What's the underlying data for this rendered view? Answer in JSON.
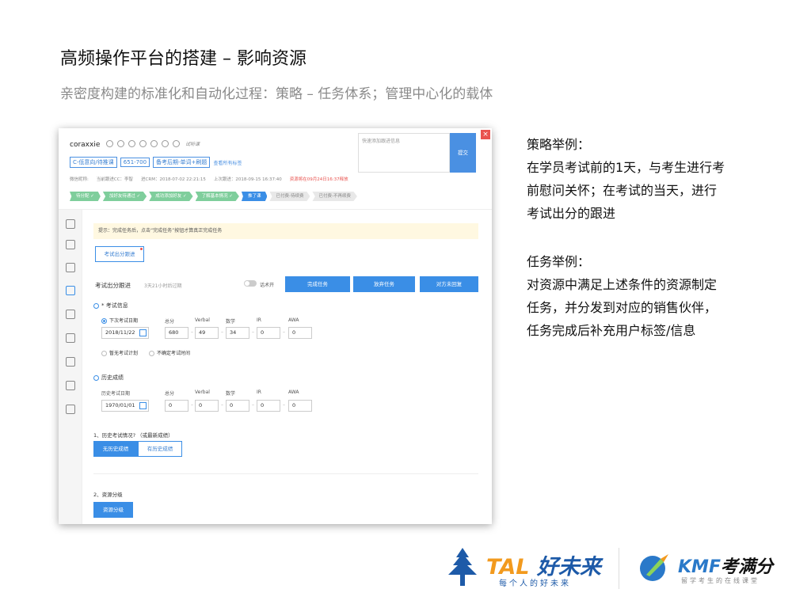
{
  "slide": {
    "title": "高频操作平台的搭建 – 影响资源",
    "subtitle": "亲密度构建的标准化和自动化过程：策略 – 任务体系；管理中心化的载体"
  },
  "crm": {
    "name": "coraxxie",
    "trial_label": "试听课",
    "close_icon": "×",
    "tags": [
      "C-低意向/待推课",
      "651-700",
      "备考后期-单词+刷题"
    ],
    "tags_link": "查看所有标签",
    "meta": [
      "微信昵称:",
      "当前跟进CC：李智",
      "进CRM：2018-07-02 22:21:15",
      "上次跟进：2018-09-15 16:37:40",
      "资源将在09月24日16:37释放"
    ],
    "steps": [
      {
        "label": "待分配 ✓",
        "state": "done"
      },
      {
        "label": "加好友待通过 ✓",
        "state": "done"
      },
      {
        "label": "成功添加好友 ✓",
        "state": "done"
      },
      {
        "label": "了解基本情况 ✓",
        "state": "done"
      },
      {
        "label": "推了课",
        "state": "active"
      },
      {
        "label": "已付费-待续费",
        "state": "todo"
      },
      {
        "label": "已付费-不再续费",
        "state": "todo"
      }
    ],
    "quick_placeholder": "快速添加跟进信息",
    "submit_label": "提交",
    "tip": "提示：完成任务后，点击“完成任务”按钮才算真正完成任务",
    "active_tab": "考试出分跟进",
    "task": {
      "title": "考试出分跟进",
      "time_left": "3天21小时后过期",
      "toggle_label": "话术开",
      "complete_btn": "完成任务",
      "abandon_btn": "放弃任务",
      "reply_btn": "对方未回复"
    },
    "exam_info": {
      "section": "* 考试信息",
      "next_exam_label": "下次考试日期",
      "columns": [
        "总分",
        "Verbal",
        "数学",
        "IR",
        "AWA"
      ],
      "date": "2018/11/22",
      "values": [
        "680",
        "49",
        "34",
        "0",
        "0"
      ],
      "no_plan": "暂无考试计划",
      "unsure": "不确定考试时间"
    },
    "history": {
      "section": "历史成绩",
      "date_label": "历史考试日期",
      "columns": [
        "总分",
        "Verbal",
        "数学",
        "IR",
        "AWA"
      ],
      "date": "1970/01/01",
      "values": [
        "0",
        "0",
        "0",
        "0",
        "0"
      ]
    },
    "q1": {
      "label": "1、历史考试情况? （或最新成绩）",
      "opt_no": "无历史成绩",
      "opt_yes": "有历史成绩"
    },
    "q2": {
      "label": "2、资源分级",
      "button": "资源分级"
    }
  },
  "notes": {
    "strategy_heading": "策略举例：",
    "strategy_lines": [
      "在学员考试前的1天，与考生进行考",
      "前慰问关怀；在考试的当天，进行",
      "考试出分的跟进"
    ],
    "task_heading": "任务举例：",
    "task_lines": [
      "对资源中满足上述条件的资源制定",
      "任务，并分发到对应的销售伙伴，",
      "任务完成后补充用户标签/信息"
    ]
  },
  "logos": {
    "tal_main": "TAL",
    "tal_cn": "好未来",
    "tal_slogan": "每个人的好未来",
    "kmf_main": "KMF",
    "kmf_cn": "考满分",
    "kmf_slogan": "留学考生的在线课堂",
    "tal_color": "#1d5aa8",
    "tal_accent": "#f29a1e",
    "kmf_color": "#2a79c9"
  }
}
